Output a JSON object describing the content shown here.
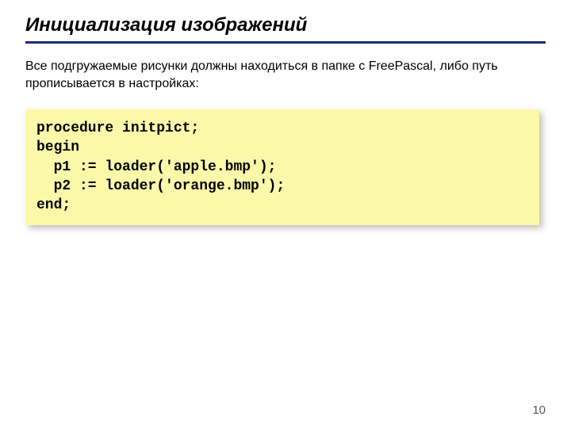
{
  "title": "Инициализация изображений",
  "description": "Все подгружаемые рисунки должны находиться в папке с FreePascal, либо путь прописывается в настройках:",
  "code": "procedure initpict;\nbegin\n  p1 := loader('apple.bmp');\n  p2 := loader('orange.bmp');\nend;",
  "page_number": "10"
}
